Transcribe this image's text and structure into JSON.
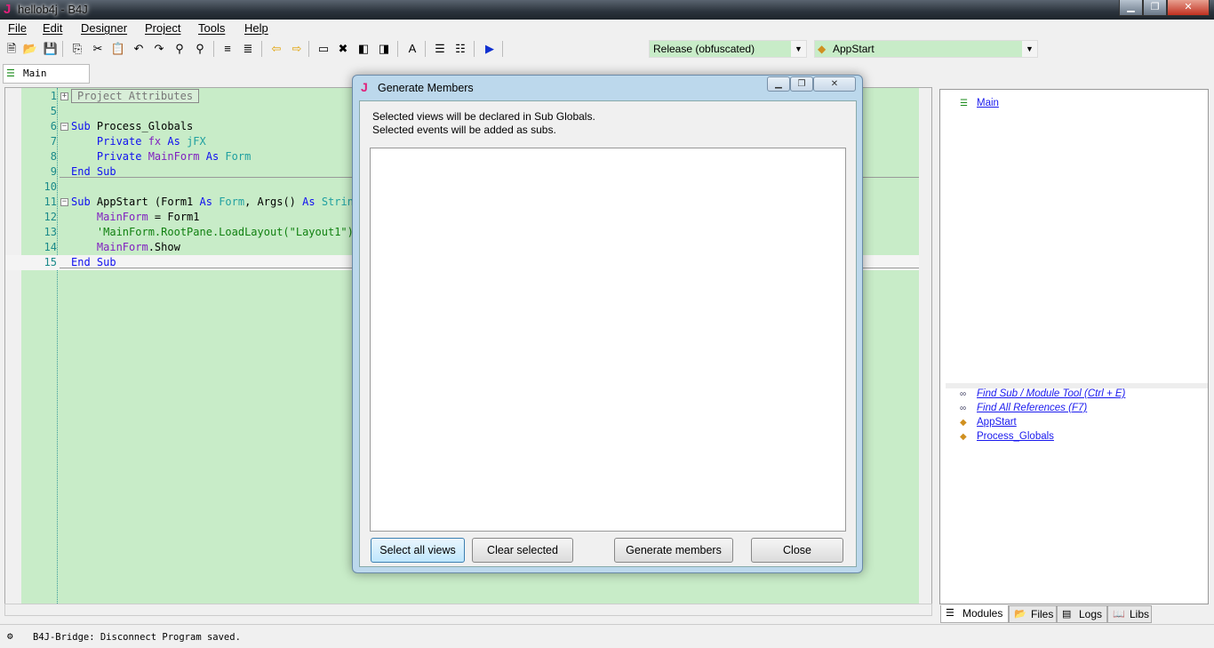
{
  "window": {
    "title": "hellob4j - B4J",
    "logo": "J"
  },
  "menu": [
    "File",
    "Edit",
    "Designer",
    "Project",
    "Tools",
    "Help"
  ],
  "toolbar": {
    "icons": [
      "new-file-icon",
      "open-folder-icon",
      "save-icon",
      "copy-icon",
      "cut-icon",
      "paste-icon",
      "undo-icon",
      "redo-icon",
      "find-icon",
      "find-add-icon",
      "indent-icon",
      "outdent-icon",
      "back-arrow-icon",
      "forward-arrow-icon",
      "bookmark-icon",
      "remove-bookmark-icon",
      "prev-bookmark-icon",
      "next-bookmark-icon",
      "autocomplete-icon",
      "comment-icon",
      "uncomment-icon",
      "run-icon"
    ],
    "build_config": "Release (obfuscated)",
    "module_sub": "AppStart"
  },
  "module_tab": "Main",
  "editor": {
    "lines": [
      {
        "n": "1",
        "fold": "+",
        "tokens": [
          {
            "t": "Project Attributes",
            "c": "pa"
          }
        ]
      },
      {
        "n": "5",
        "tokens": []
      },
      {
        "n": "6",
        "fold": "-",
        "tokens": [
          {
            "t": "Sub ",
            "c": "kw"
          },
          {
            "t": "Process_Globals",
            "c": "pl"
          }
        ]
      },
      {
        "n": "7",
        "tokens": [
          {
            "t": "    Private ",
            "c": "kw"
          },
          {
            "t": "fx ",
            "c": "var"
          },
          {
            "t": "As ",
            "c": "kw"
          },
          {
            "t": "jFX",
            "c": "type"
          }
        ]
      },
      {
        "n": "8",
        "tokens": [
          {
            "t": "    Private ",
            "c": "kw"
          },
          {
            "t": "MainForm ",
            "c": "var"
          },
          {
            "t": "As ",
            "c": "kw"
          },
          {
            "t": "Form",
            "c": "type"
          }
        ]
      },
      {
        "n": "9",
        "tokens": [
          {
            "t": "End Sub",
            "c": "kw"
          }
        ]
      },
      {
        "n": "10",
        "tokens": []
      },
      {
        "n": "11",
        "fold": "-",
        "tokens": [
          {
            "t": "Sub ",
            "c": "kw"
          },
          {
            "t": "AppStart (Form1 ",
            "c": "pl"
          },
          {
            "t": "As ",
            "c": "kw"
          },
          {
            "t": "Form",
            "c": "type"
          },
          {
            "t": ", Args() ",
            "c": "pl"
          },
          {
            "t": "As ",
            "c": "kw"
          },
          {
            "t": "String)",
            "c": "type"
          }
        ]
      },
      {
        "n": "12",
        "tokens": [
          {
            "t": "    MainForm",
            "c": "var"
          },
          {
            "t": " = Form1",
            "c": "pl"
          }
        ]
      },
      {
        "n": "13",
        "tokens": [
          {
            "t": "    'MainForm.RootPane.LoadLayout(\"Layout1\")",
            "c": "cm"
          }
        ]
      },
      {
        "n": "14",
        "tokens": [
          {
            "t": "    MainForm",
            "c": "var"
          },
          {
            "t": ".Show",
            "c": "pl"
          }
        ]
      },
      {
        "n": "15",
        "tokens": [
          {
            "t": "End Sub",
            "c": "kw"
          }
        ]
      }
    ]
  },
  "right_panel": {
    "modules": [
      "Main"
    ],
    "links": [
      {
        "label": "Find Sub / Module Tool (Ctrl + E)",
        "icon": "binoculars-icon",
        "italic": true
      },
      {
        "label": "Find All References (F7)",
        "icon": "binoculars-icon",
        "italic": true
      },
      {
        "label": "AppStart",
        "icon": "sub-icon"
      },
      {
        "label": "Process_Globals",
        "icon": "sub-icon"
      }
    ],
    "tabs": [
      "Modules",
      "Files",
      "Logs",
      "Libs"
    ]
  },
  "status": "B4J-Bridge: Disconnect Program saved.",
  "dialog": {
    "title": "Generate Members",
    "logo": "J",
    "line1": "Selected views will be declared in Sub Globals.",
    "line2": "Selected events will be added as subs.",
    "buttons": {
      "select_all": "Select all views",
      "clear": "Clear selected",
      "generate": "Generate members",
      "close": "Close"
    }
  }
}
